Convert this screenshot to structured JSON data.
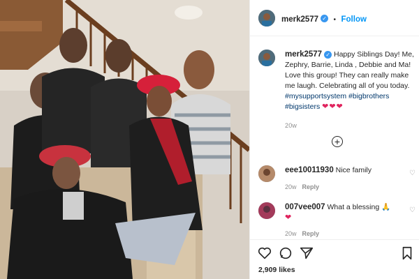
{
  "post": {
    "username": "merk2577",
    "follow_label": "Follow",
    "separator": "•",
    "caption_text": "Happy Siblings Day! Me, Zephry, Barrie, Linda , Debbie and Ma! Love this group! They can really make me laugh. Celebrating all of you today.",
    "hashtags": [
      "#mysupportsystem",
      "#bigbrothers",
      "#bigsisters"
    ],
    "hearts": "❤❤❤",
    "caption_time": "20w"
  },
  "comments": [
    {
      "username": "eee10011930",
      "text": "Nice family",
      "time": "20w",
      "reply": "Reply"
    },
    {
      "username": "007vee007",
      "text": "What a blessing 🙏",
      "extra": "❤",
      "time": "20w",
      "reply": "Reply"
    }
  ],
  "likes": "2,909 likes",
  "colors": {
    "accent": "#0095f6",
    "verified": "#3897f0",
    "hashtag": "#00376b",
    "heart": "#e0245e"
  },
  "icons": [
    "verified-icon",
    "add-comment-icon",
    "heart-icon",
    "comment-icon",
    "share-icon",
    "bookmark-icon"
  ]
}
